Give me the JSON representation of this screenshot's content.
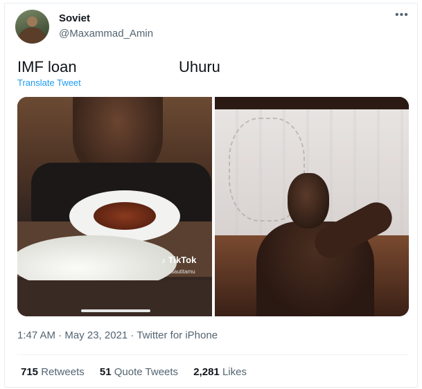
{
  "author": {
    "name": "Soviet",
    "handle": "@Maxammad_Amin"
  },
  "menu": {
    "more_glyph": "•••"
  },
  "tweet": {
    "text_left": "IMF loan",
    "text_right": "Uhuru",
    "translate_label": "Translate Tweet"
  },
  "media": {
    "watermark": "TikTok",
    "watermark_user": "sautitamu"
  },
  "meta": {
    "timestamp": "1:47 AM · May 23, 2021 · Twitter for iPhone"
  },
  "stats": {
    "retweets_count": "715",
    "retweets_label": "Retweets",
    "quotes_count": "51",
    "quotes_label": "Quote Tweets",
    "likes_count": "2,281",
    "likes_label": "Likes"
  },
  "colors": {
    "link": "#1d9bf0",
    "secondary_text": "#536471",
    "primary_text": "#0f1419"
  }
}
